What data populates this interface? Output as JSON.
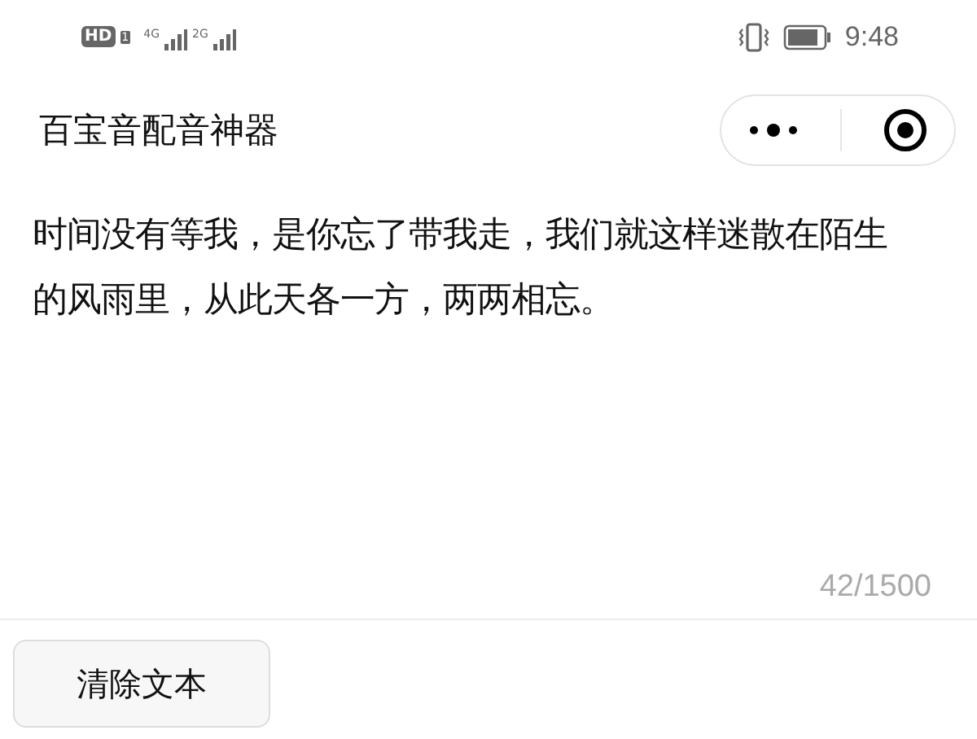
{
  "status_bar": {
    "hd": "HD",
    "sim": "1",
    "network_1": "4G",
    "network_2": "2G",
    "time": "9:48"
  },
  "title_bar": {
    "title": "百宝音配音神器"
  },
  "content": {
    "text": "时间没有等我，是你忘了带我走，我们就这样迷散在陌生的风雨里，从此天各一方，两两相忘。",
    "counter": "42/1500"
  },
  "buttons": [
    {
      "label": "清除文本"
    }
  ]
}
